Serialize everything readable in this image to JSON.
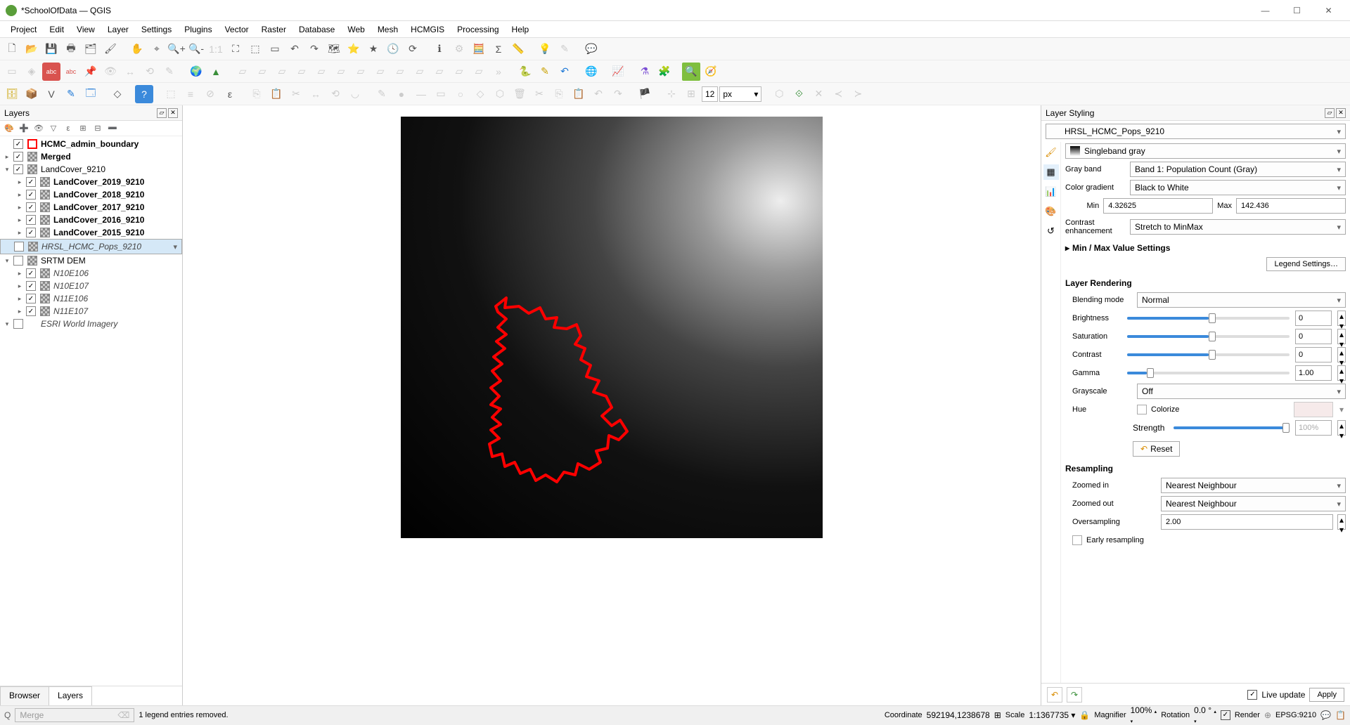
{
  "window": {
    "title": "*SchoolOfData — QGIS"
  },
  "menu": [
    "Project",
    "Edit",
    "View",
    "Layer",
    "Settings",
    "Plugins",
    "Vector",
    "Raster",
    "Database",
    "Web",
    "Mesh",
    "HCMGIS",
    "Processing",
    "Help"
  ],
  "toolbar3": {
    "segments_value": "12",
    "segments_unit": "px"
  },
  "layers_panel": {
    "title": "Layers",
    "items": [
      {
        "indent": 0,
        "toggle": "",
        "checked": true,
        "swatch": "red",
        "label": "HCMC_admin_boundary",
        "bold": true
      },
      {
        "indent": 0,
        "toggle": "▸",
        "checked": true,
        "swatch": "raster",
        "label": "Merged",
        "bold": true
      },
      {
        "indent": 0,
        "toggle": "▾",
        "checked": true,
        "swatch": "raster",
        "label": "LandCover_9210"
      },
      {
        "indent": 1,
        "toggle": "▸",
        "checked": true,
        "swatch": "raster",
        "label": "LandCover_2019_9210",
        "bold": true
      },
      {
        "indent": 1,
        "toggle": "▸",
        "checked": true,
        "swatch": "raster",
        "label": "LandCover_2018_9210",
        "bold": true
      },
      {
        "indent": 1,
        "toggle": "▸",
        "checked": true,
        "swatch": "raster",
        "label": "LandCover_2017_9210",
        "bold": true
      },
      {
        "indent": 1,
        "toggle": "▸",
        "checked": true,
        "swatch": "raster",
        "label": "LandCover_2016_9210",
        "bold": true
      },
      {
        "indent": 1,
        "toggle": "▸",
        "checked": true,
        "swatch": "raster",
        "label": "LandCover_2015_9210",
        "bold": true
      },
      {
        "indent": 0,
        "toggle": "",
        "checked": false,
        "swatch": "raster",
        "label": "HRSL_HCMC_Pops_9210",
        "ital": true,
        "sel": true
      },
      {
        "indent": 0,
        "toggle": "▾",
        "checked": false,
        "swatch": "raster",
        "label": "SRTM DEM"
      },
      {
        "indent": 1,
        "toggle": "▸",
        "checked": true,
        "swatch": "raster",
        "label": "N10E106",
        "ital": true
      },
      {
        "indent": 1,
        "toggle": "▸",
        "checked": true,
        "swatch": "raster",
        "label": "N10E107",
        "ital": true
      },
      {
        "indent": 1,
        "toggle": "▸",
        "checked": true,
        "swatch": "raster",
        "label": "N11E106",
        "ital": true
      },
      {
        "indent": 1,
        "toggle": "▸",
        "checked": true,
        "swatch": "raster",
        "label": "N11E107",
        "ital": true
      },
      {
        "indent": 0,
        "toggle": "▾",
        "checked": false,
        "swatch": "",
        "label": "ESRI World Imagery",
        "ital": true
      }
    ],
    "tabs": {
      "browser": "Browser",
      "layers": "Layers"
    }
  },
  "styling": {
    "title": "Layer Styling",
    "layer": "HRSL_HCMC_Pops_9210",
    "renderer": "Singleband gray",
    "gray_band_label": "Gray band",
    "gray_band": "Band 1: Population Count (Gray)",
    "color_gradient_label": "Color gradient",
    "color_gradient": "Black to White",
    "min_label": "Min",
    "min": "4.32625",
    "max_label": "Max",
    "max": "142.436",
    "contrast_label": "Contrast enhancement",
    "contrast": "Stretch to MinMax",
    "minmax_header": "Min / Max Value Settings",
    "legend_btn": "Legend Settings…",
    "rendering_header": "Layer Rendering",
    "blending_label": "Blending mode",
    "blending": "Normal",
    "brightness_label": "Brightness",
    "brightness_val": "0",
    "saturation_label": "Saturation",
    "saturation_val": "0",
    "contrast2_label": "Contrast",
    "contrast2_val": "0",
    "gamma_label": "Gamma",
    "gamma_val": "1.00",
    "grayscale_label": "Grayscale",
    "grayscale": "Off",
    "hue_label": "Hue",
    "colorize_label": "Colorize",
    "strength_label": "Strength",
    "strength_val": "100%",
    "reset_btn": "Reset",
    "resampling_header": "Resampling",
    "zoomin_label": "Zoomed in",
    "zoomin": "Nearest Neighbour",
    "zoomout_label": "Zoomed out",
    "zoomout": "Nearest Neighbour",
    "oversampling_label": "Oversampling",
    "oversampling": "2.00",
    "early_label": "Early resampling",
    "live_update": "Live update",
    "apply": "Apply"
  },
  "search": {
    "placeholder": "Merge",
    "status": "1 legend entries removed."
  },
  "status": {
    "coord_label": "Coordinate",
    "coord": "592194,1238678",
    "scale_label": "Scale",
    "scale": "1:1367735",
    "magnifier_label": "Magnifier",
    "magnifier": "100%",
    "rotation_label": "Rotation",
    "rotation": "0.0 °",
    "render_label": "Render",
    "crs": "EPSG:9210"
  }
}
